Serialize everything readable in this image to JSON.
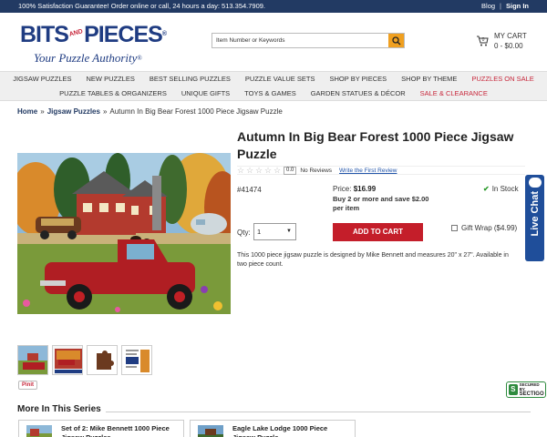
{
  "topbar": {
    "message": "100% Satisfaction Guarantee! Order online or call, 24 hours a day: 513.354.7909.",
    "blog": "Blog",
    "signin": "Sign In"
  },
  "logo": {
    "bits": "BITS",
    "and": "AND",
    "pieces": "PIECES",
    "reg": "®",
    "tagline": "Your Puzzle Authority",
    "tagline_reg": "®"
  },
  "search": {
    "placeholder": "Item Number or Keywords",
    "icon": "search-icon"
  },
  "cart": {
    "title": "MY CART",
    "value": "0 - $0.00",
    "icon": "cart-icon"
  },
  "nav": {
    "row1": [
      {
        "label": "JIGSAW PUZZLES",
        "red": false
      },
      {
        "label": "NEW PUZZLES",
        "red": false
      },
      {
        "label": "BEST SELLING PUZZLES",
        "red": false
      },
      {
        "label": "PUZZLE VALUE SETS",
        "red": false
      },
      {
        "label": "SHOP BY PIECES",
        "red": false
      },
      {
        "label": "SHOP BY THEME",
        "red": false
      },
      {
        "label": "PUZZLES ON SALE",
        "red": true
      }
    ],
    "row2": [
      {
        "label": "PUZZLE TABLES & ORGANIZERS",
        "red": false
      },
      {
        "label": "UNIQUE GIFTS",
        "red": false
      },
      {
        "label": "TOYS & GAMES",
        "red": false
      },
      {
        "label": "GARDEN STATUES & DÉCOR",
        "red": false
      },
      {
        "label": "SALE & CLEARANCE",
        "red": true
      }
    ]
  },
  "breadcrumb": {
    "home": "Home",
    "sep": "»",
    "category": "Jigsaw Puzzles",
    "current": "Autumn In Big Bear Forest 1000 Piece Jigsaw Puzzle"
  },
  "product": {
    "title": "Autumn In Big Bear Forest 1000 Piece Jigsaw Puzzle",
    "rating_score": "0.0",
    "reviews": "No Reviews",
    "write_review": "Write the First Review",
    "sku": "#41474",
    "price_label": "Price:",
    "price": "$16.99",
    "promo": "Buy 2 or more and save $2.00 per item",
    "stock": "In Stock",
    "qty_label": "Qty:",
    "qty_value": "1",
    "add_to_cart": "ADD TO CART",
    "gift_wrap": "Gift Wrap ($4.99)",
    "description": "This 1000 piece jigsaw puzzle is designed by Mike Bennett and measures 20\" x 27\". Available in two piece count.",
    "pinit": "Pinit"
  },
  "livechat": {
    "label": "Live Chat"
  },
  "sectigo": {
    "line1": "SECURED BY",
    "line2": "SECTIGO"
  },
  "series": {
    "title": "More In This Series",
    "items": [
      {
        "label": "Set of 2: Mike Bennett 1000 Piece Jigsaw Puzzles"
      },
      {
        "label": "Eagle Lake Lodge 1000 Piece Jigsaw Puzzle"
      }
    ]
  },
  "colors": {
    "topbar": "#223a63",
    "brand_blue": "#1f3c82",
    "accent_red": "#c41e2a",
    "search_button": "#f0a020",
    "in_stock_green": "#2a9a2a"
  }
}
